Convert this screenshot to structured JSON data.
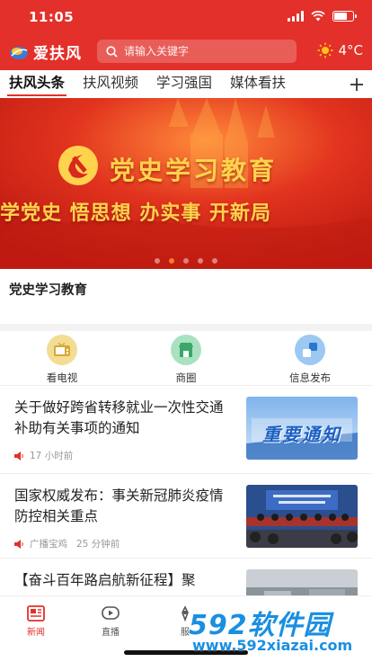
{
  "status_bar": {
    "time": "11:05"
  },
  "header": {
    "app_name": "爱扶风",
    "search_placeholder": "请输入关键字",
    "weather": "4°C"
  },
  "tabs": [
    {
      "label": "扶风头条",
      "active": true
    },
    {
      "label": "扶风视频",
      "active": false
    },
    {
      "label": "学习强国",
      "active": false
    },
    {
      "label": "媒体看扶",
      "active": false
    }
  ],
  "banner": {
    "title": "党史学习教育",
    "subtitle": "学党史  悟思想  办实事  开新局",
    "page_count": 5,
    "active_page": 2
  },
  "section_title": "党史学习教育",
  "quick_nav": [
    {
      "label": "看电视",
      "icon": "tv-icon",
      "color": "#e9c65a"
    },
    {
      "label": "商圈",
      "icon": "shop-icon",
      "color": "#5cc08a"
    },
    {
      "label": "信息发布",
      "icon": "info-publish-icon",
      "color": "#3a8ee6"
    }
  ],
  "news": [
    {
      "title": "关于做好跨省转移就业一次性交通补助有关事项的通知",
      "source": "",
      "time": "17 小时前",
      "thumb_text": "重要通知"
    },
    {
      "title": "国家权威发布：事关新冠肺炎疫情防控相关重点",
      "source": "广播宝鸡",
      "time": "25 分钟前",
      "thumb_text": ""
    },
    {
      "title": "【奋斗百年路启航新征程】聚",
      "source": "",
      "time": "",
      "thumb_text": ""
    }
  ],
  "bottom_nav": [
    {
      "label": "新闻",
      "icon": "news-icon",
      "active": true
    },
    {
      "label": "直播",
      "icon": "live-icon",
      "active": false
    },
    {
      "label": "服",
      "icon": "service-icon",
      "active": false
    }
  ],
  "watermark": {
    "big": "592软件园",
    "small": "www.592xiazai.com"
  },
  "colors": {
    "brand_red": "#e3302a",
    "banner_gold": "#ffd34d",
    "watermark_blue": "#1a8fe0"
  }
}
